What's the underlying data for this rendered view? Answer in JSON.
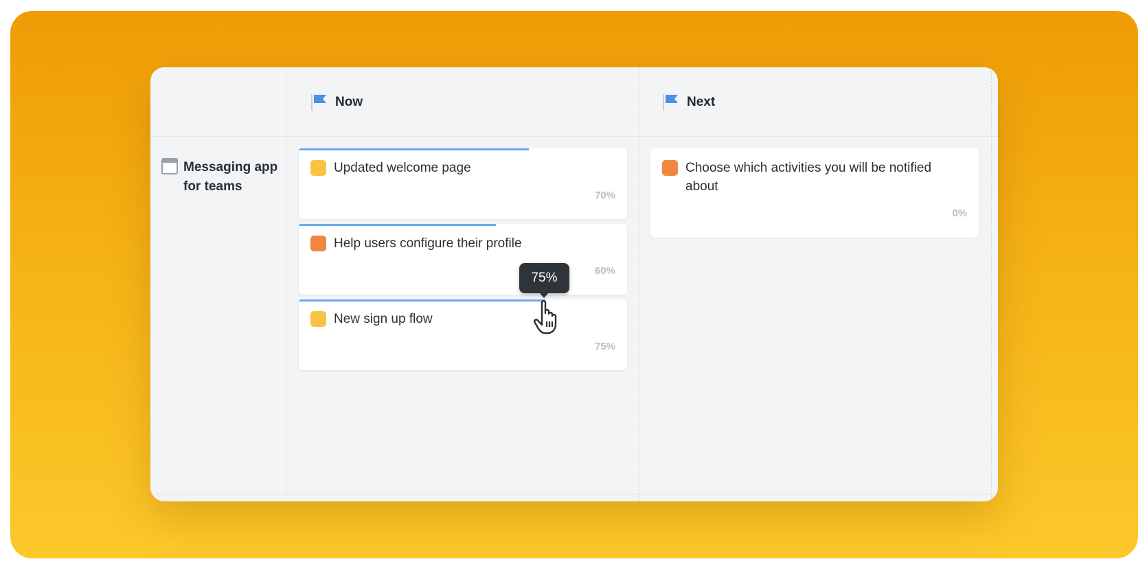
{
  "columns": [
    {
      "title": "Now",
      "icon": "flag-icon"
    },
    {
      "title": "Next",
      "icon": "flag-icon"
    }
  ],
  "row": {
    "title": "Messaging app for teams",
    "icon": "window-icon"
  },
  "cards": [
    {
      "title": "Updated welcome page",
      "percent_label": "70%",
      "progress": 0.7,
      "color": "#f9c443"
    },
    {
      "title": "Help users configure their profile",
      "percent_label": "60%",
      "progress": 0.6,
      "color": "#ef8741"
    },
    {
      "title": "New sign up flow",
      "percent_label": "75%",
      "progress": 0.75,
      "color": "#f9c443"
    },
    {
      "title": "Choose which activities you will be notified about",
      "percent_label": "0%",
      "progress": 0,
      "color": "#ef8741"
    }
  ],
  "tooltip": {
    "text": "75%"
  },
  "colors": {
    "accent": "#4a90e8",
    "progress": "#6aaaf0",
    "backdrop_top": "#ef9c06",
    "backdrop_bottom": "#fcc92a"
  }
}
